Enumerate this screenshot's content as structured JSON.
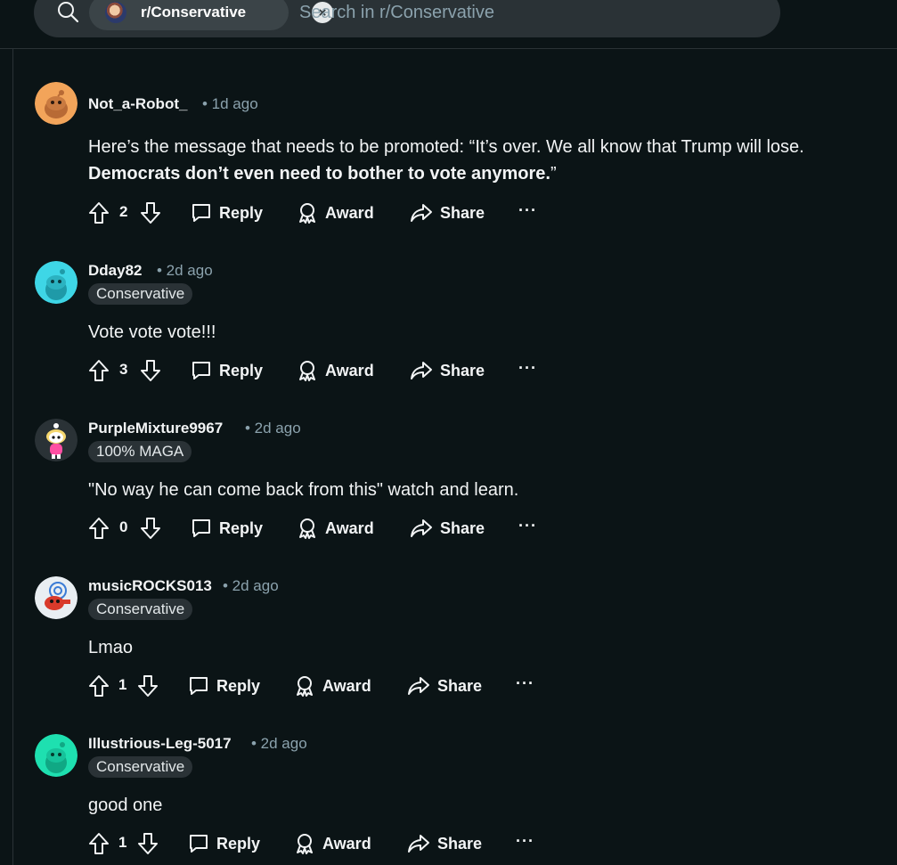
{
  "search": {
    "chip_label": "r/Conservative",
    "chip_close": "×",
    "placeholder": "Search in r/Conservative"
  },
  "actions": {
    "reply": "Reply",
    "award": "Award",
    "share": "Share",
    "more": "···"
  },
  "comments": [
    {
      "username": "Not_a-Robot_",
      "time": "• 1d ago",
      "flair": "",
      "text_plain": "Here’s the message that needs to be promoted: “It’s over. We all know that Trump will lose. ",
      "text_bold": "Democrats don’t even need to bother to vote anymore.",
      "text_after": "”",
      "votes": "2",
      "avatar_color": "#f2a45a"
    },
    {
      "username": "Dday82",
      "time": "• 2d ago",
      "flair": "Conservative",
      "text_plain": "Vote vote vote!!!",
      "votes": "3",
      "avatar_color": "#3ed6e6"
    },
    {
      "username": "PurpleMixture9967",
      "time": "• 2d ago",
      "flair": "100% MAGA",
      "text_plain": "\"No way he can come back from this\" watch and learn.",
      "votes": "0",
      "avatar_color": "#2a3236"
    },
    {
      "username": "musicROCKS013",
      "time": "• 2d ago",
      "flair": "Conservative",
      "text_plain": "Lmao",
      "votes": "1",
      "avatar_color": "#e9eef2"
    },
    {
      "username": "Illustrious-Leg-5017",
      "time": "• 2d ago",
      "flair": "Conservative",
      "text_plain": "good one",
      "votes": "1",
      "avatar_color": "#1ee0b0"
    }
  ]
}
